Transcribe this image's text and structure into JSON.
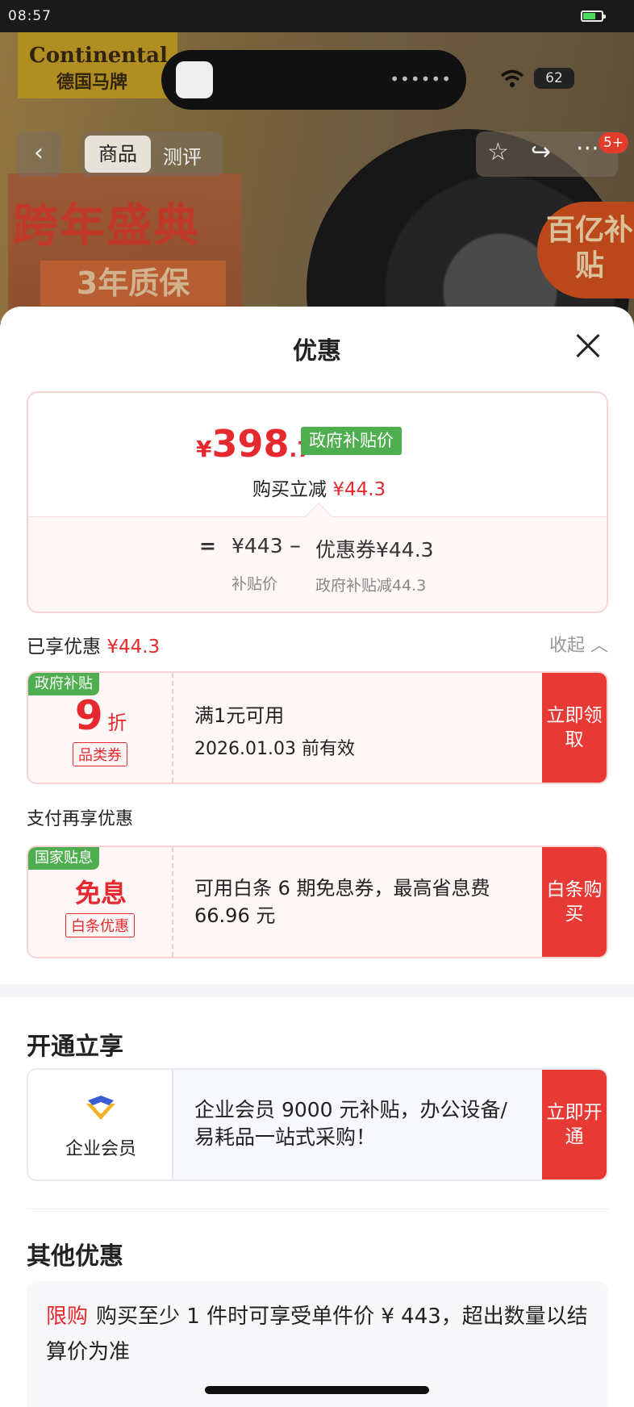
{
  "status": {
    "time": "08:57",
    "battery_badge": "62"
  },
  "hero": {
    "brand": "Continental",
    "brand_cn": "德国马牌",
    "poster_title": "跨年盛典",
    "poster_sub": "3年质保",
    "subsidy_badge": "百亿补贴",
    "tab_active": "商品",
    "tab_inactive": "测评",
    "notif_count": "5+"
  },
  "sheet": {
    "title": "优惠",
    "price": {
      "currency": "¥",
      "integer": "398",
      "decimal": ".7",
      "tag": "政府补贴价",
      "instant_label": "购买立减",
      "instant_value": "¥44.3"
    },
    "formula": {
      "eq": "=",
      "base": "¥443",
      "minus": "–",
      "coupon": "优惠券¥44.3",
      "base_label": "补贴价",
      "coupon_label": "政府补贴减44.3"
    },
    "enjoyed": {
      "label": "已享优惠",
      "value": "¥44.3",
      "collapse": "收起"
    },
    "coupon1": {
      "tag": "政府补贴",
      "discount": "9",
      "unit": "折",
      "kind": "品类券",
      "line1": "满1元可用",
      "line2": "2026.01.03 前有效",
      "button": "立即领取"
    },
    "pay_label": "支付再享优惠",
    "coupon2": {
      "tag": "国家贴息",
      "title": "免息",
      "kind": "白条优惠",
      "text": "可用白条 6 期免息券，最高省息费 66.96 元",
      "button": "白条购买"
    },
    "open_title": "开通立享",
    "enterprise": {
      "label": "企业会员",
      "text": "企业会员 9000 元补贴，办公设备/易耗品一站式采购！",
      "button": "立即开通"
    },
    "other_title": "其他优惠",
    "other": {
      "tag": "限购",
      "text": "购买至少 1 件时可享受单件价 ¥ 443，超出数量以结算价为准"
    }
  },
  "colors": {
    "red": "#e6292f",
    "green": "#4fae4f",
    "button_red": "#e83a35"
  }
}
